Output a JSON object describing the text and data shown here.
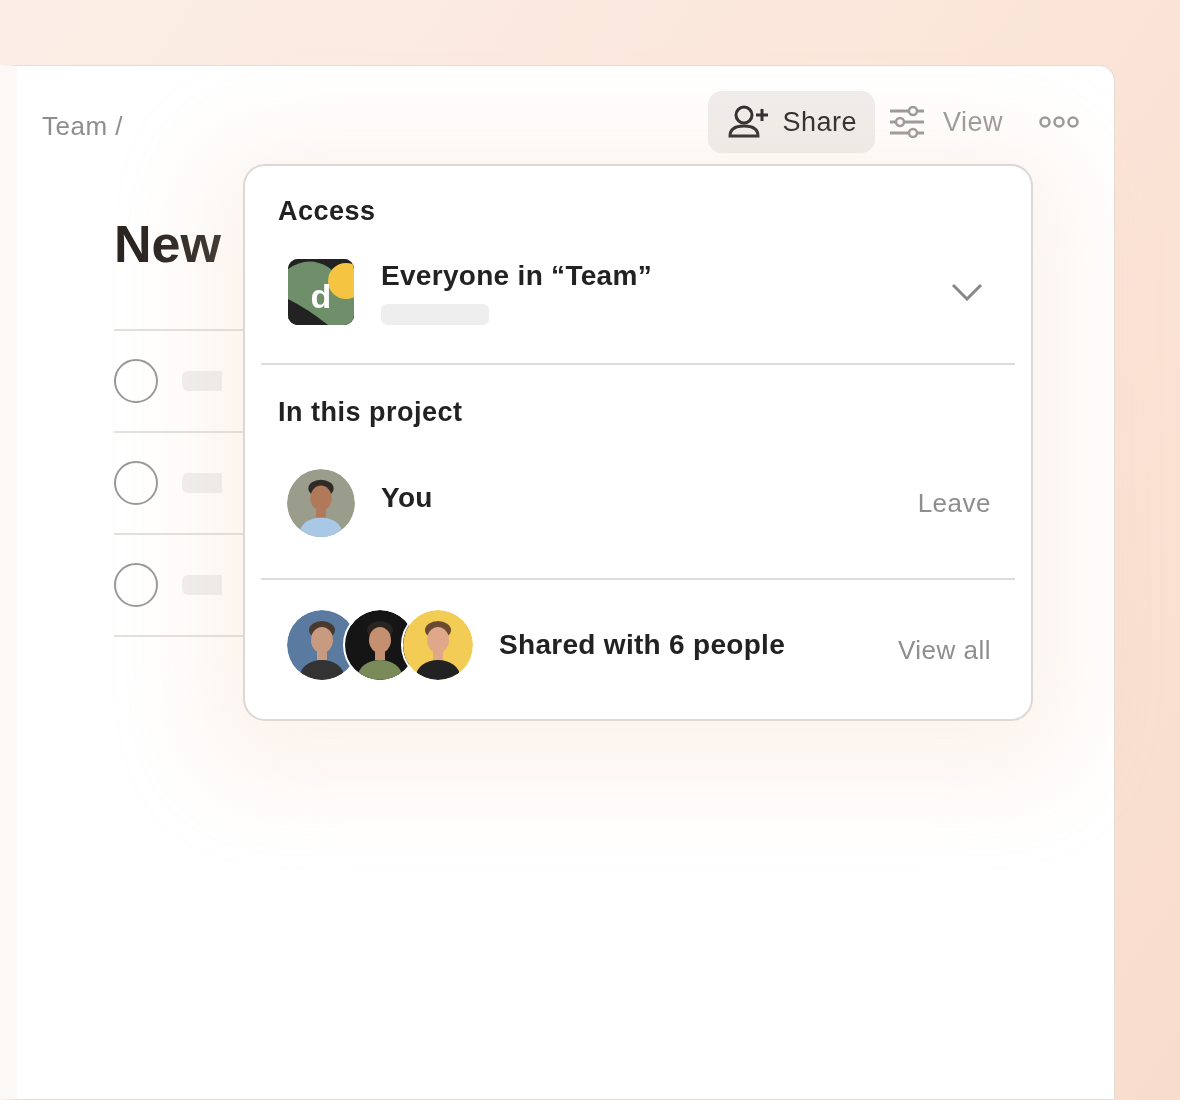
{
  "breadcrumb": "Team /",
  "toolbar": {
    "share": "Share",
    "view": "View"
  },
  "page_title": "New",
  "tasks": [
    {
      "checked": false
    },
    {
      "checked": false
    },
    {
      "checked": false
    }
  ],
  "popover": {
    "access_heading": "Access",
    "access": {
      "logo_letter": "d",
      "label": "Everyone in “Team”",
      "expanded": false
    },
    "project_heading": "In this project",
    "members": [
      {
        "name": "You",
        "action": "Leave"
      }
    ],
    "shared": {
      "label": "Shared with 6 people",
      "action": "View all"
    }
  }
}
